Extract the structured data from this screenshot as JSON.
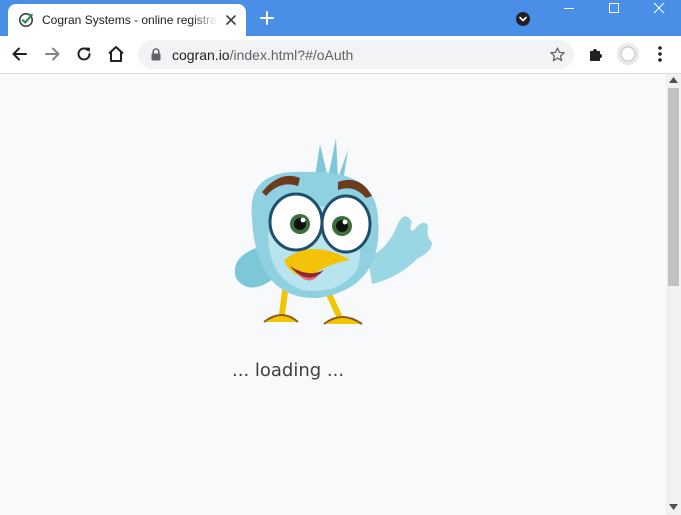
{
  "browser": {
    "tab": {
      "title": "Cogran Systems - online registration",
      "favicon": "check-circle-icon"
    },
    "new_tab_icon": "plus-icon",
    "tab_search_icon": "tab-search-icon",
    "window_controls": [
      "minimize-icon",
      "maximize-icon",
      "close-icon"
    ],
    "toolbar": {
      "back_icon": "arrow-left-icon",
      "forward_icon": "arrow-right-icon",
      "reload_icon": "reload-icon",
      "home_icon": "home-icon"
    },
    "address_bar": {
      "host": "cogran.io",
      "path": "/index.html?#/oAuth",
      "lock_icon": "lock-icon",
      "bookmark_icon": "star-icon"
    },
    "extensions_icon": "puzzle-icon",
    "menu_icon": "kebab-menu-icon",
    "colors": {
      "titlebar": "#4a8fe7",
      "tab_active": "#ffffff",
      "omnibox": "#f1f3f4",
      "page_background": "#f8f9fa"
    }
  },
  "page": {
    "mascot": "cartoon-bird-waving",
    "loading_text": "... loading ..."
  }
}
